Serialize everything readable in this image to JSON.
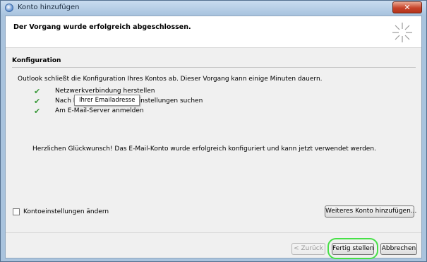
{
  "window": {
    "title": "Konto hinzufügen",
    "close_glyph": "✕"
  },
  "header": {
    "text": "Der Vorgang wurde erfolgreich abgeschlossen."
  },
  "config": {
    "title": "Konfiguration",
    "intro": "Outlook schließt die Konfiguration Ihres Kontos ab. Dieser Vorgang kann einige Minuten dauern.",
    "steps": [
      {
        "label": "Netzwerkverbindung herstellen",
        "status": "done",
        "check": "✔"
      },
      {
        "label": "Nach Ihrer Emailadresse-Einstellungen suchen",
        "status": "done",
        "check": "✔"
      },
      {
        "label": "Am E-Mail-Server anmelden",
        "status": "done",
        "check": "✔"
      }
    ],
    "tooltip": "Ihrer Emailadresse",
    "congrats": "Herzlichen Glückwunsch! Das E-Mail-Konto wurde erfolgreich konfiguriert und kann jetzt verwendet werden."
  },
  "options": {
    "change_settings_label": "Kontoeinstellungen ändern",
    "change_settings_checked": false,
    "add_another_label": "Weiteres Konto hinzufügen..."
  },
  "footer": {
    "back_label": "< Zurück",
    "finish_label": "Fertig stellen",
    "cancel_label": "Abbrechen"
  },
  "colors": {
    "check": "#3b9a3b",
    "highlight": "#46e046",
    "close": "#c7432a"
  }
}
